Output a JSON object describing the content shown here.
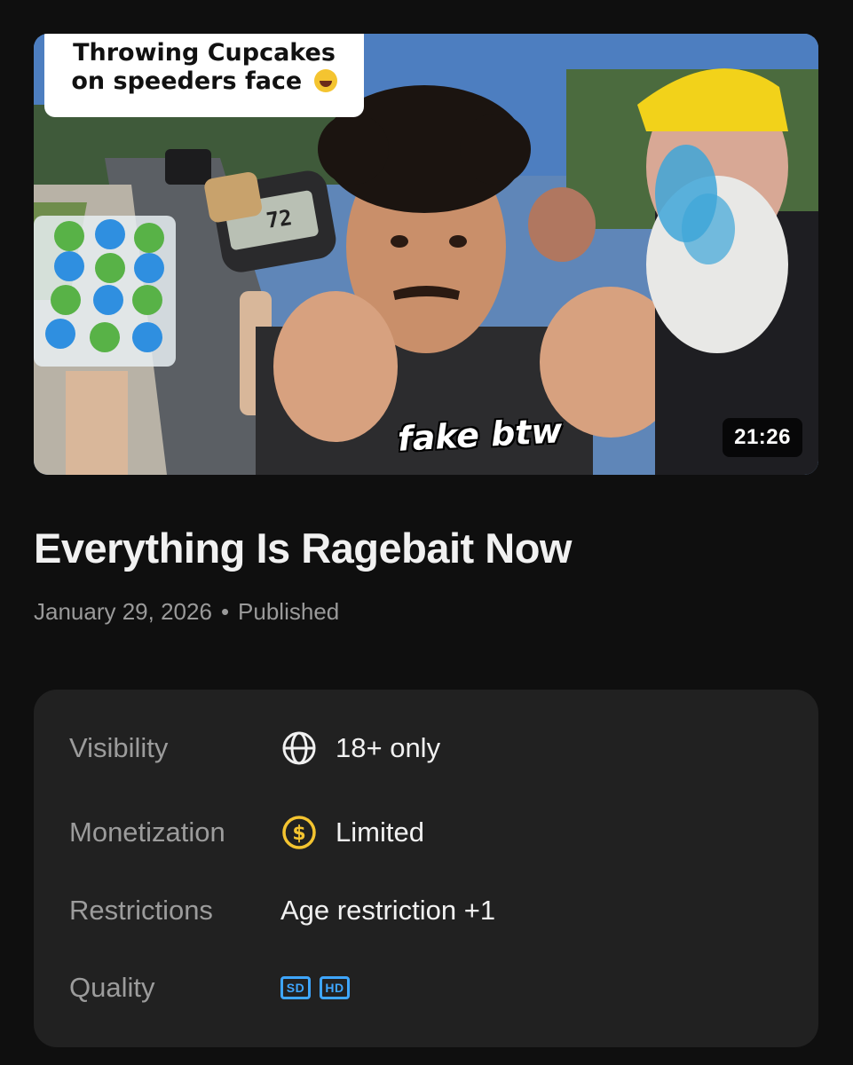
{
  "thumbnail": {
    "caption_line1": "Throwing Cupcakes",
    "caption_line2": "on speeders face",
    "radar_reading": "72",
    "overlay_text": "fake btw",
    "duration": "21:26"
  },
  "video": {
    "title": "Everything Is Ragebait Now",
    "date": "January 29, 2026",
    "separator": "•",
    "status": "Published"
  },
  "details": {
    "visibility": {
      "label": "Visibility",
      "value": "18+ only",
      "icon": "globe-icon"
    },
    "monetization": {
      "label": "Monetization",
      "value": "Limited",
      "icon": "dollar-circle-icon",
      "icon_color": "#f4c430"
    },
    "restrictions": {
      "label": "Restrictions",
      "value": "Age restriction +1"
    },
    "quality": {
      "label": "Quality",
      "badges": [
        "SD",
        "HD"
      ],
      "badge_color": "#3ea6ff"
    }
  }
}
